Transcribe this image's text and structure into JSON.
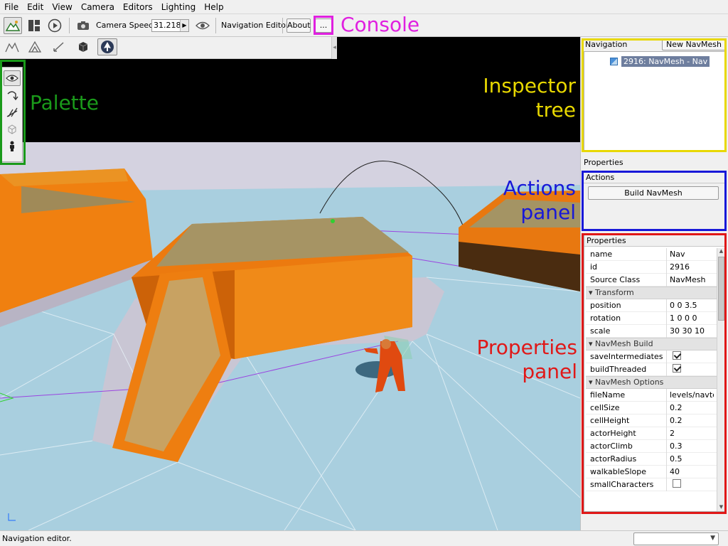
{
  "menubar": {
    "items": [
      "File",
      "Edit",
      "View",
      "Camera",
      "Editors",
      "Lighting",
      "Help"
    ]
  },
  "toolbar": {
    "camera_speed_label": "Camera Speed",
    "camera_speed_value": "31.218",
    "editor_label": "Navigation Editor",
    "about_label": "About",
    "console_label": "..."
  },
  "navigation": {
    "header": "Navigation",
    "new_navmesh_label": "New NavMesh",
    "tree_item": "2916: NavMesh - Nav"
  },
  "properties_tab": "Properties",
  "actions": {
    "title": "Actions",
    "build_label": "Build NavMesh"
  },
  "properties": {
    "title": "Properties",
    "rows": [
      {
        "name": "name",
        "value": "Nav"
      },
      {
        "name": "id",
        "value": "2916"
      },
      {
        "name": "Source Class",
        "value": "NavMesh"
      }
    ],
    "transform": {
      "section": "Transform",
      "rows": [
        {
          "name": "position",
          "value": "0 0 3.5"
        },
        {
          "name": "rotation",
          "value": "1 0 0 0"
        },
        {
          "name": "scale",
          "value": "30 30 10"
        }
      ]
    },
    "build": {
      "section": "NavMesh Build",
      "rows": [
        {
          "name": "saveIntermediates",
          "checked": true
        },
        {
          "name": "buildThreaded",
          "checked": true
        }
      ]
    },
    "options": {
      "section": "NavMesh Options",
      "rows": [
        {
          "name": "fileName",
          "value": "levels/navte"
        },
        {
          "name": "cellSize",
          "value": "0.2"
        },
        {
          "name": "cellHeight",
          "value": "0.2"
        },
        {
          "name": "actorHeight",
          "value": "2"
        },
        {
          "name": "actorClimb",
          "value": "0.3"
        },
        {
          "name": "actorRadius",
          "value": "0.5"
        },
        {
          "name": "walkableSlope",
          "value": "40"
        },
        {
          "name": "smallCharacters",
          "checked": false
        }
      ]
    }
  },
  "statusbar": {
    "text": "Navigation editor."
  },
  "annotations": {
    "console": {
      "text": "Console",
      "color": "#e020e0"
    },
    "palette": {
      "text": "Palette",
      "color": "#1a9a1a"
    },
    "inspector": {
      "line1": "Inspector",
      "line2": "tree",
      "color": "#e8d800"
    },
    "actions": {
      "line1": "Actions",
      "line2": "panel",
      "color": "#1818d8"
    },
    "properties": {
      "line1": "Properties",
      "line2": "panel",
      "color": "#e01818"
    }
  }
}
